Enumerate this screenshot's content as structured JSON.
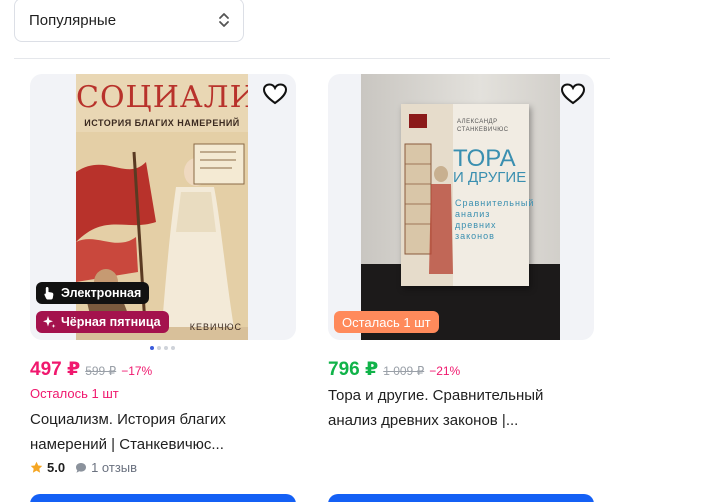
{
  "sort": {
    "value": "Популярные"
  },
  "colors": {
    "accent": "#1460f5",
    "sale": "#f0186e",
    "green": "#10b349",
    "badge_friday": "#a4124d",
    "badge_stock": "#ff8a5b"
  },
  "products": [
    {
      "cover": {
        "title": "СОЦИАЛИЗМ",
        "subtitle": "ИСТОРИЯ БЛАГИХ НАМЕРЕНИЙ",
        "author": "КЕВИЧЮС"
      },
      "badges": {
        "ebook": "Электронная",
        "friday": "Чёрная пятница"
      },
      "price": "497 ₽",
      "old_price": "599 ₽",
      "discount": "−17%",
      "stock": "Осталось 1 шт",
      "title": "Социализм. История благих намерений | Станкевичюс...",
      "rating": "5.0",
      "reviews": "1 отзыв",
      "icons": {
        "favorite": "heart-icon",
        "rating": "star-icon",
        "reviews": "comment-icon"
      }
    },
    {
      "cover": {
        "author": "АЛЕКСАНДР СТАНКЕВИЧЮС",
        "title_1": "ТОРА",
        "title_2": "И ДРУГИЕ",
        "sub_1": "Сравнительный",
        "sub_2": "анализ",
        "sub_3": "древних",
        "sub_4": "законов"
      },
      "badges": {
        "stock": "Осталась 1 шт"
      },
      "price": "796 ₽",
      "old_price": "1 009 ₽",
      "discount": "−21%",
      "title": "Тора и другие. Сравнительный анализ древних законов |...",
      "icons": {
        "favorite": "heart-icon"
      }
    }
  ]
}
